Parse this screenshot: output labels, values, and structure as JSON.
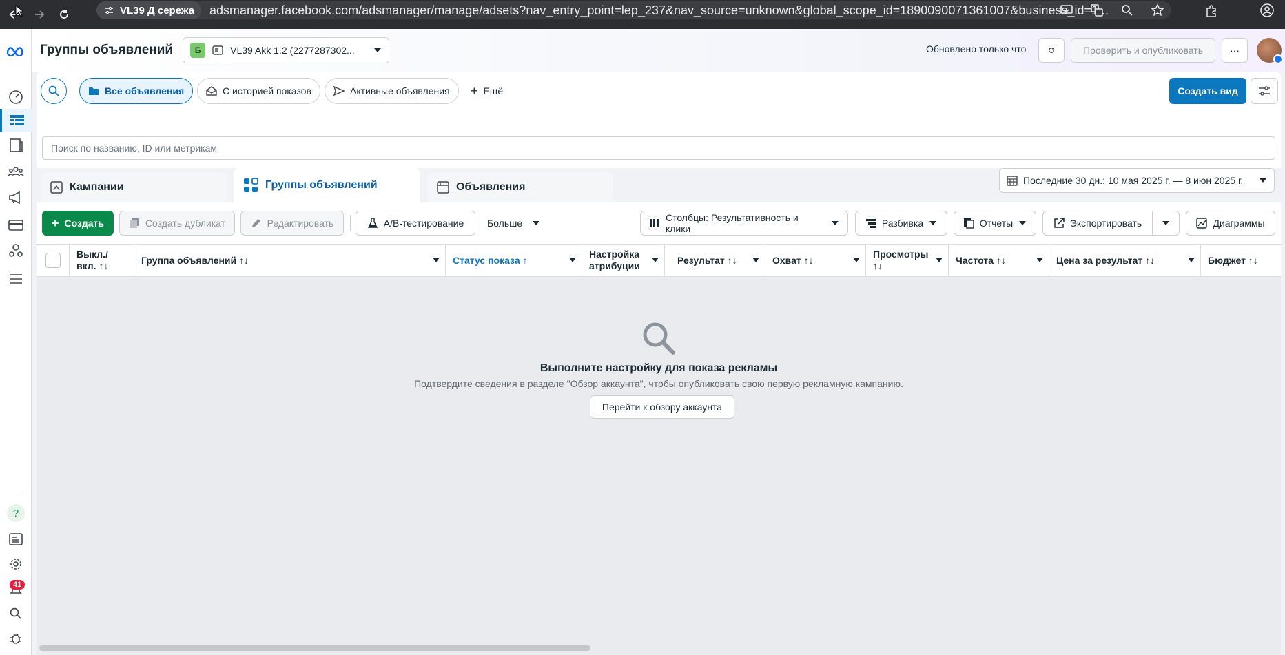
{
  "browser": {
    "tab_label": "VL39 Д сережа",
    "url": "adsmanager.facebook.com/adsmanager/manage/adsets?nav_entry_point=lep_237&nav_source=unknown&global_scope_id=1890090071361007&business_id=1..."
  },
  "header": {
    "title": "Группы объявлений",
    "account_badge": "Б",
    "account_name": "VL39 Akk 1.2 (2277287302...",
    "updated": "Обновлено только что",
    "publish_label": "Проверить и опубликовать",
    "more_label": "···"
  },
  "filters": {
    "all_ads": "Все объявления",
    "with_history": "С историей показов",
    "active_ads": "Активные объявления",
    "more": "Ещё",
    "create_view": "Создать вид"
  },
  "search": {
    "placeholder": "Поиск по названию, ID или метрикам"
  },
  "tabs": {
    "campaigns": "Кампании",
    "adsets": "Группы объявлений",
    "ads": "Объявления"
  },
  "date_range": "Последние 30 дн.: 10 мая 2025 г. — 8 июн 2025 г.",
  "toolbar": {
    "create": "Создать",
    "duplicate": "Создать дубликат",
    "edit": "Редактировать",
    "ab_test": "A/B-тестирование",
    "more": "Больше",
    "columns": "Столбцы: Результативность и клики",
    "breakdown": "Разбивка",
    "reports": "Отчеты",
    "export": "Экспортировать",
    "charts": "Диаграммы"
  },
  "columns": [
    "Выкл./ вкл. ↑↓",
    "Группа объявлений ↑↓",
    "Статус показа ↑",
    "Настройка атрибуции",
    "Результат ↑↓",
    "Охват ↑↓",
    "Просмотры ↑↓",
    "Частота ↑↓",
    "Цена за результат ↑↓",
    "Бюджет ↑↓"
  ],
  "empty": {
    "title": "Выполните настройку для показа рекламы",
    "subtitle": "Подтвердите сведения в разделе \"Обзор аккаунта\", чтобы опубликовать свою первую рекламную кампанию.",
    "button": "Перейти к обзору аккаунта"
  },
  "rail": {
    "notification_count": "41"
  },
  "colors": {
    "accent": "#0a78be",
    "create": "#0a8a4a",
    "badge": "#e41e3f"
  }
}
